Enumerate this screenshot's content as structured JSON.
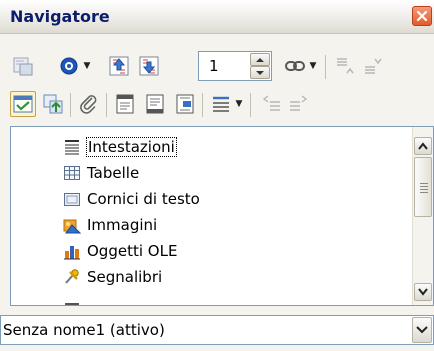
{
  "window": {
    "title": "Navigatore"
  },
  "toolbar1": {
    "page_number": "1",
    "items": [
      "navigation-icon",
      "navigation-dropdown",
      "previous-icon",
      "next-icon",
      "page-spinner",
      "drag-mode-icon",
      "drag-mode-dropdown",
      "promote-chapter-icon",
      "demote-chapter-icon"
    ]
  },
  "toolbar2": {
    "items": [
      "toggle-content-icon",
      "header-icon",
      "reminder-icon",
      "header-navigation-icon",
      "footer-navigation-icon",
      "anchor-text-icon",
      "heading-levels-icon",
      "heading-levels-dropdown",
      "promote-level-icon",
      "demote-level-icon"
    ],
    "content_toggle_checked": true
  },
  "content_list": {
    "items": [
      {
        "label": "Intestazioni",
        "icon": "headings-icon"
      },
      {
        "label": "Tabelle",
        "icon": "tables-icon"
      },
      {
        "label": "Cornici di testo",
        "icon": "text-frames-icon"
      },
      {
        "label": "Immagini",
        "icon": "images-icon"
      },
      {
        "label": "Oggetti OLE",
        "icon": "ole-objects-icon"
      },
      {
        "label": "Segnalibri",
        "icon": "bookmarks-icon"
      }
    ],
    "selected_index": 0
  },
  "document_selector": {
    "value": "Senza nome1 (attivo)"
  },
  "colors": {
    "title_text": "#0b1d6b",
    "close_button": "#e25b2a",
    "selection_frame": "#c6a14a",
    "border": "#7f9db9"
  }
}
